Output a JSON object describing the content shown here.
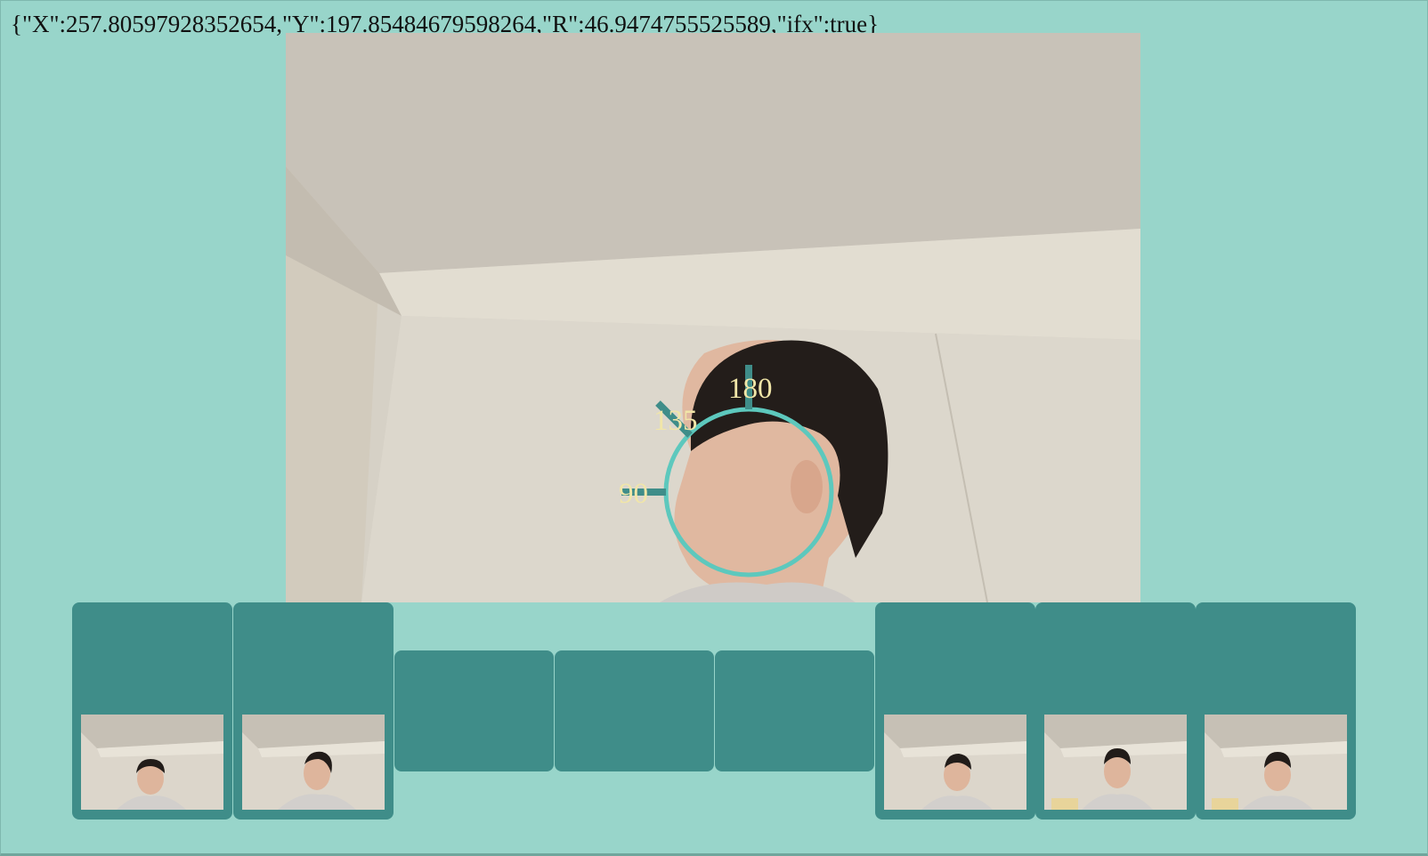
{
  "readout": {
    "text": "{\"X\":257.80597928352654,\"Y\":197.85484679598264,\"R\":46.9474755525589,\"ifx\":true}"
  },
  "camera": {
    "angle_labels": [
      "180",
      "135",
      "90"
    ],
    "ring_color": "#5dc8bd",
    "label_color": "#f1e6a8"
  },
  "gallery": {
    "slot_color": "#3f8d89",
    "slots": [
      {
        "state": "captured"
      },
      {
        "state": "captured"
      },
      {
        "state": "empty"
      },
      {
        "state": "empty"
      },
      {
        "state": "empty"
      },
      {
        "state": "captured"
      },
      {
        "state": "captured"
      },
      {
        "state": "captured"
      }
    ]
  }
}
